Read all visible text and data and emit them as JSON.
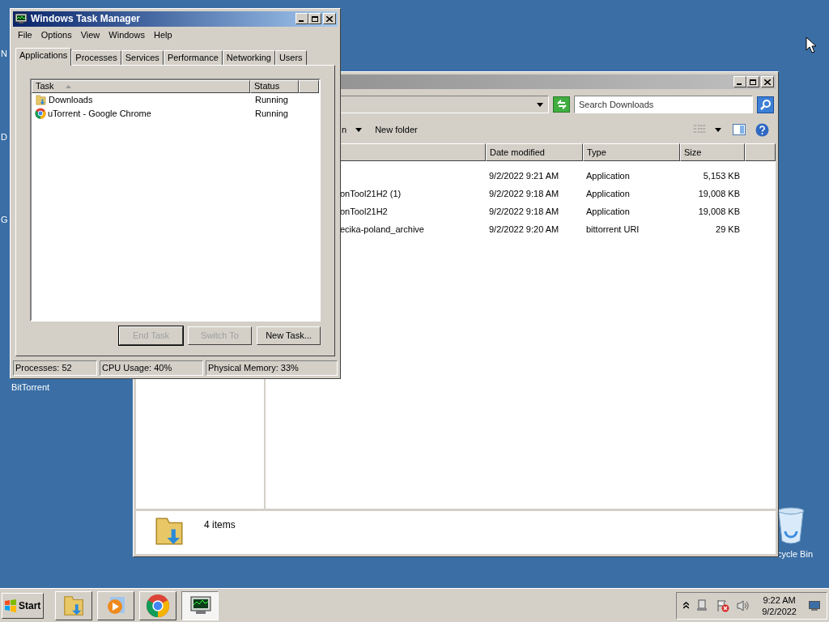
{
  "desktop": {
    "icons": [
      {
        "label": "N"
      },
      {
        "label": "D"
      },
      {
        "label": "G"
      },
      {
        "label": "BitTorrent"
      }
    ],
    "recycle_bin": {
      "label": "cycle Bin"
    }
  },
  "explorer": {
    "active": false,
    "search": {
      "placeholder": "Search Downloads"
    },
    "toolbar": {
      "organize": "n",
      "new_folder": "New folder"
    },
    "columns": [
      {
        "label": "Date modified"
      },
      {
        "label": "Type"
      },
      {
        "label": "Size"
      }
    ],
    "rows": [
      {
        "date": "9/2/2022 9:21 AM",
        "type": "Application",
        "size": "5,153 KB"
      },
      {
        "name": "onTool21H2 (1)",
        "date": "9/2/2022 9:18 AM",
        "type": "Application",
        "size": "19,008 KB"
      },
      {
        "name": "onTool21H2",
        "date": "9/2/2022 9:18 AM",
        "type": "Application",
        "size": "19,008 KB"
      },
      {
        "name": "ecika-poland_archive",
        "date": "9/2/2022 9:20 AM",
        "type": "bittorrent URI",
        "size": "29 KB"
      }
    ],
    "details": "4 items"
  },
  "task_manager": {
    "title": "Windows Task Manager",
    "active": true,
    "menu": [
      "File",
      "Options",
      "View",
      "Windows",
      "Help"
    ],
    "tabs": [
      {
        "label": "Applications",
        "selected": true
      },
      {
        "label": "Processes",
        "selected": false
      },
      {
        "label": "Services",
        "selected": false
      },
      {
        "label": "Performance",
        "selected": false
      },
      {
        "label": "Networking",
        "selected": false
      },
      {
        "label": "Users",
        "selected": false
      }
    ],
    "columns": [
      "Task",
      "Status"
    ],
    "tasks": [
      {
        "kind": "folder",
        "name": "Downloads",
        "status": "Running"
      },
      {
        "kind": "chrome",
        "name": "uTorrent - Google Chrome",
        "status": "Running"
      }
    ],
    "buttons": [
      {
        "label": "End Task",
        "disabled": true,
        "default": true
      },
      {
        "label": "Switch To",
        "disabled": true,
        "default": false
      },
      {
        "label": "New Task...",
        "disabled": false,
        "default": false
      }
    ],
    "status_bar": [
      "Processes: 52",
      "CPU Usage: 40%",
      "Physical Memory: 33%"
    ]
  },
  "taskbar": {
    "start": "Start",
    "buttons": [
      {
        "kind": "explorer",
        "selected": false
      },
      {
        "kind": "media",
        "selected": false
      },
      {
        "kind": "chrome",
        "selected": false
      },
      {
        "kind": "taskmgr",
        "selected": true
      }
    ],
    "clock": {
      "time": "9:22 AM",
      "date": "9/2/2022"
    }
  }
}
